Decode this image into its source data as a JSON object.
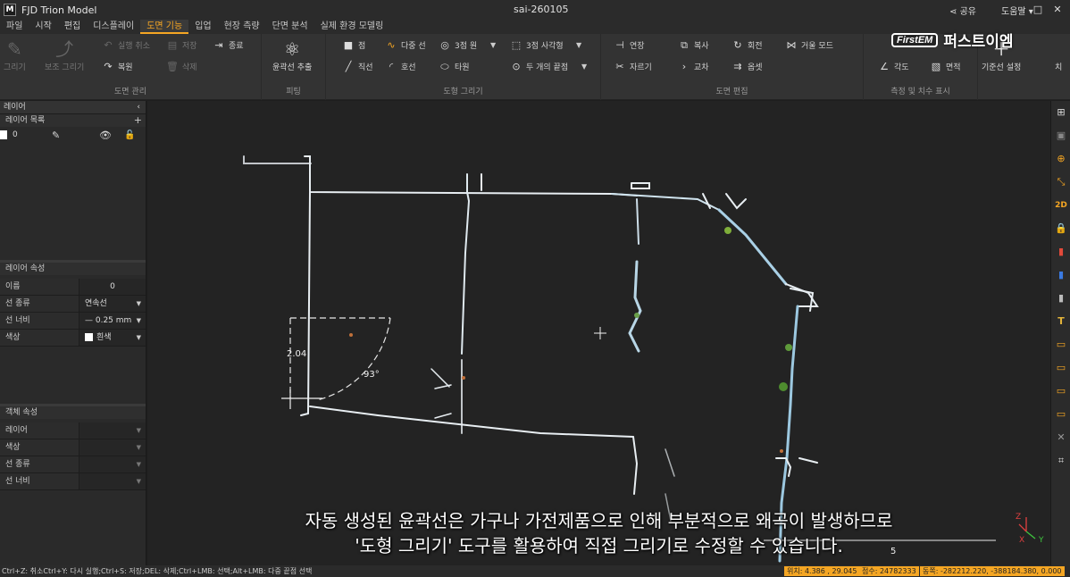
{
  "titlebar": {
    "app_logo": "M",
    "app_title": "FJD Trion Model",
    "doc_title": "sai-260105",
    "share": "공유",
    "help": "도움말",
    "minimize": "–",
    "maximize": "□",
    "close": "✕"
  },
  "menu": [
    "파일",
    "시작",
    "편집",
    "디스플레이",
    "도면 기능",
    "입업",
    "현장 측량",
    "단면 분석",
    "실제 환경 모델링"
  ],
  "menu_active_index": 4,
  "ribbon": {
    "group_drawing_mgmt": {
      "title": "도면 관리",
      "draw": "그리기",
      "aux_draw": "보조 그리기",
      "undo": "실행 취소",
      "redo": "복원",
      "save": "저장",
      "delete": "삭제",
      "exit": "종료"
    },
    "group_shape": {
      "title": "피팅",
      "extract_contour": "윤곽선 추출"
    },
    "group_draw_shapes": {
      "title": "도형 그리기",
      "point": "점",
      "polyline": "다중 선",
      "circle3": "3점 원",
      "rect3": "3점 사각형",
      "line": "직선",
      "arc": "호선",
      "ellipse": "타원",
      "two_point_hole": "두 개의 끝점"
    },
    "group_edit": {
      "title": "도면 편집",
      "extend": "연장",
      "copy": "복사",
      "rotate": "회전",
      "mirror": "거울 모드",
      "trim": "자르기",
      "intersect": "교차",
      "offset": "옵셋"
    },
    "group_measure": {
      "title": "측정 및 치수 표시",
      "distance": "거리",
      "angle": "각도",
      "area": "면적"
    },
    "group_ref": {
      "ref_settings": "기준선 설정",
      "more": "치"
    }
  },
  "brand": {
    "box": "FirstEM",
    "text": "퍼스트이엠"
  },
  "left_panel": {
    "layer_title": "레이어",
    "layer_list_title": "레이어 목록",
    "layers": [
      {
        "name": "0"
      }
    ],
    "layer_props_title": "레이어 속성",
    "layer_props": [
      {
        "key": "이름",
        "value": "0"
      },
      {
        "key": "선 종류",
        "value": "연속선"
      },
      {
        "key": "선 너비",
        "value": "— 0.25 mm"
      },
      {
        "key": "색상",
        "value": "흰색"
      }
    ],
    "object_props_title": "객체 속성",
    "object_props": [
      {
        "key": "레이어",
        "value": ""
      },
      {
        "key": "색상",
        "value": ""
      },
      {
        "key": "선 종류",
        "value": ""
      },
      {
        "key": "선 너비",
        "value": ""
      }
    ]
  },
  "viewport": {
    "dim_length": "2.04",
    "dim_angle": "93°",
    "scale_label": "5",
    "axis_z": "Z",
    "axis_x": "X",
    "axis_y": "Y",
    "subtitle_line1": "자동 생성된 윤곽선은 가구나 가전제품으로 인해 부분적으로 왜곡이 발생하므로",
    "subtitle_line2": "'도형 그리기' 도구를 활용하여 직접 그리기로 수정할 수 있습니다."
  },
  "right_tools": [
    "⊞",
    "▣",
    "⊕",
    "⤡",
    "2D",
    "🔒",
    "▮",
    "▮",
    "▮",
    "T",
    "▭",
    "▭",
    "▭",
    "▭",
    "✕",
    "⌗"
  ],
  "statusbar": {
    "hint": "Ctrl+Z: 취소Ctrl+Y: 다시 실행;Ctrl+S: 저장;DEL: 삭제;Ctrl+LMB: 선택;Alt+LMB: 다중 끝점 선택",
    "position": "위치: 4.386 , 29.045",
    "points": "점수: 24782333",
    "coords": "동쪽: -282212.220, -388184.380, 0.000"
  },
  "colors": {
    "accent": "#f5a623",
    "panel_bg": "#2a2a2a",
    "viewport_bg": "#232323"
  }
}
